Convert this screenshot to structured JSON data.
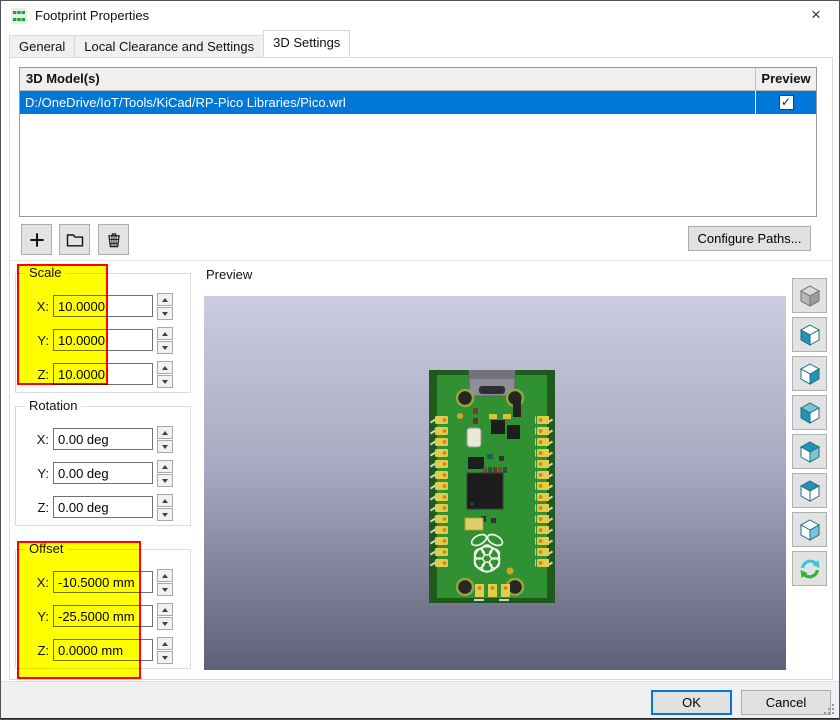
{
  "window": {
    "title": "Footprint Properties"
  },
  "icons": {
    "titlebar": "kicad-footprint-icon",
    "close": "×",
    "check": "✓",
    "table_toolbar": [
      "add-model-icon",
      "browse-folder-icon",
      "delete-model-icon"
    ],
    "view_toolbar": [
      "isometric-view-icon",
      "view-left-icon",
      "view-right-icon",
      "view-front-icon",
      "view-back-icon",
      "view-top-icon",
      "view-bottom-icon",
      "reload-view-icon"
    ]
  },
  "tabs": [
    {
      "label": "General",
      "active": false
    },
    {
      "label": "Local Clearance and Settings",
      "active": false
    },
    {
      "label": "3D Settings",
      "active": true
    }
  ],
  "model_table": {
    "header_model": "3D Model(s)",
    "header_preview": "Preview",
    "rows": [
      {
        "path": "D:/OneDrive/IoT/Tools/KiCad/RP-Pico Libraries/Pico.wrl",
        "preview_checked": true
      }
    ]
  },
  "buttons": {
    "configure_paths": "Configure Paths...",
    "ok": "OK",
    "cancel": "Cancel"
  },
  "axis_labels": {
    "x": "X:",
    "y": "Y:",
    "z": "Z:"
  },
  "groups": {
    "scale": {
      "label": "Scale",
      "x": "10.0000",
      "y": "10.0000",
      "z": "10.0000",
      "highlighted": true
    },
    "rotation": {
      "label": "Rotation",
      "x": "0.00 deg",
      "y": "0.00 deg",
      "z": "0.00 deg",
      "highlighted": false
    },
    "offset": {
      "label": "Offset",
      "x": "-10.5000 mm",
      "y": "-25.5000 mm",
      "z": "0.0000 mm",
      "highlighted": true
    }
  },
  "preview_panel": {
    "label": "Preview"
  },
  "colors": {
    "selection": "#0078d7",
    "highlight_fill": "#ffff00",
    "highlight_border": "#ff0000",
    "viewport_top": "#cbccdf",
    "viewport_bottom": "#5f5f78",
    "pcb_green": "#2f9132",
    "pad_gold": "#e3cb4b"
  }
}
